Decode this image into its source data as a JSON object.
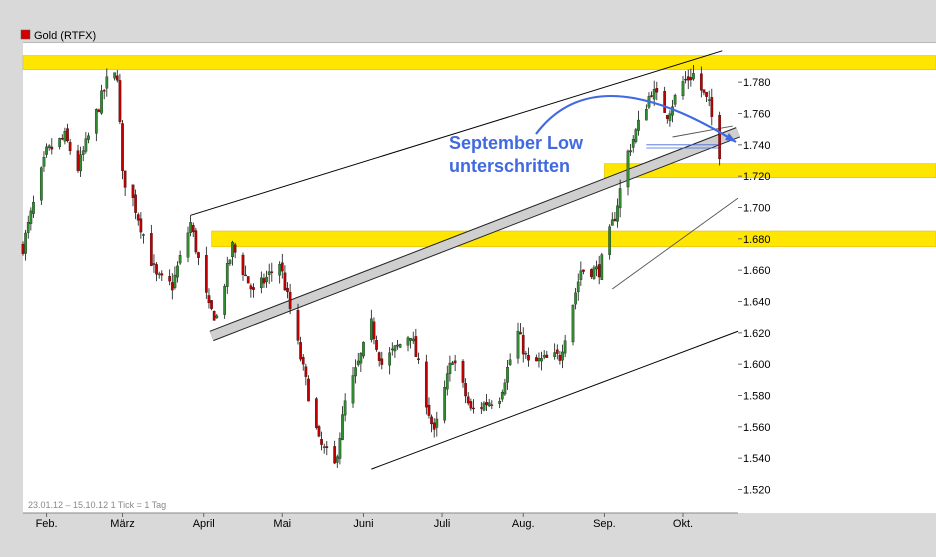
{
  "header": {
    "instrument": "Gold (RTFX)"
  },
  "chart_data": {
    "type": "candlestick",
    "title": "Gold (RTFX)",
    "footer_note": "23.01.12 – 15.10.12   1 Tick = 1 Tag",
    "annotation": [
      "September Low",
      "unterschritten"
    ],
    "y_ticks": [
      "1.520",
      "1.540",
      "1.560",
      "1.580",
      "1.600",
      "1.620",
      "1.640",
      "1.660",
      "1.680",
      "1.700",
      "1.720",
      "1.740",
      "1.760",
      "1.780"
    ],
    "y_tick_values": [
      1520,
      1540,
      1560,
      1580,
      1600,
      1620,
      1640,
      1660,
      1680,
      1700,
      1720,
      1740,
      1760,
      1780
    ],
    "ylim": [
      1505,
      1805
    ],
    "x_months": [
      {
        "label": "Feb.",
        "date": "2012-02-01"
      },
      {
        "label": "März",
        "date": "2012-03-01"
      },
      {
        "label": "April",
        "date": "2012-04-01"
      },
      {
        "label": "Mai",
        "date": "2012-05-01"
      },
      {
        "label": "Juni",
        "date": "2012-06-01"
      },
      {
        "label": "Juli",
        "date": "2012-07-01"
      },
      {
        "label": "Aug.",
        "date": "2012-08-01"
      },
      {
        "label": "Sep.",
        "date": "2012-09-01"
      },
      {
        "label": "Okt.",
        "date": "2012-10-01"
      }
    ],
    "xlim": [
      "2012-01-23",
      "2012-10-22"
    ],
    "price_path": [
      [
        "2012-01-23",
        1675
      ],
      [
        "2012-02-01",
        1735
      ],
      [
        "2012-02-08",
        1745
      ],
      [
        "2012-02-13",
        1725
      ],
      [
        "2012-02-24",
        1780
      ],
      [
        "2012-02-28",
        1785
      ],
      [
        "2012-03-01",
        1720
      ],
      [
        "2012-03-05",
        1705
      ],
      [
        "2012-03-14",
        1655
      ],
      [
        "2012-03-20",
        1650
      ],
      [
        "2012-03-27",
        1690
      ],
      [
        "2012-04-03",
        1635
      ],
      [
        "2012-04-06",
        1630
      ],
      [
        "2012-04-12",
        1675
      ],
      [
        "2012-04-20",
        1645
      ],
      [
        "2012-04-30",
        1665
      ],
      [
        "2012-05-04",
        1635
      ],
      [
        "2012-05-15",
        1550
      ],
      [
        "2012-05-21",
        1535
      ],
      [
        "2012-05-25",
        1575
      ],
      [
        "2012-06-04",
        1625
      ],
      [
        "2012-06-08",
        1600
      ],
      [
        "2012-06-19",
        1620
      ],
      [
        "2012-06-28",
        1555
      ],
      [
        "2012-07-05",
        1605
      ],
      [
        "2012-07-12",
        1570
      ],
      [
        "2012-07-23",
        1580
      ],
      [
        "2012-07-30",
        1620
      ],
      [
        "2012-08-03",
        1600
      ],
      [
        "2012-08-15",
        1605
      ],
      [
        "2012-08-23",
        1660
      ],
      [
        "2012-08-30",
        1660
      ],
      [
        "2012-09-05",
        1695
      ],
      [
        "2012-09-10",
        1735
      ],
      [
        "2012-09-19",
        1775
      ],
      [
        "2012-09-25",
        1760
      ],
      [
        "2012-10-01",
        1780
      ],
      [
        "2012-10-05",
        1785
      ],
      [
        "2012-10-11",
        1765
      ],
      [
        "2012-10-15",
        1735
      ]
    ],
    "horizontal_zones": [
      {
        "y": [
          1788,
          1797
        ],
        "from": "2012-01-23",
        "color": "#ffe600"
      },
      {
        "y": [
          1719,
          1728
        ],
        "from": "2012-09-01",
        "color": "#ffe600"
      },
      {
        "y": [
          1675,
          1685
        ],
        "from": "2012-04-04",
        "color": "#ffe600"
      }
    ],
    "trend_lines": [
      {
        "style": "thin",
        "p1": [
          "2012-03-27",
          1695
        ],
        "p2": [
          "2012-10-16",
          1800
        ]
      },
      {
        "style": "thin",
        "p1": [
          "2012-09-27",
          1745
        ],
        "p2": [
          "2012-10-20",
          1752
        ]
      },
      {
        "style": "band",
        "p1": [
          "2012-04-04",
          1618
        ],
        "p2": [
          "2012-10-22",
          1748
        ]
      },
      {
        "style": "thin",
        "p1": [
          "2012-09-04",
          1648
        ],
        "p2": [
          "2012-10-22",
          1706
        ]
      },
      {
        "style": "thin",
        "p1": [
          "2012-06-04",
          1533
        ],
        "p2": [
          "2012-10-22",
          1621
        ]
      },
      {
        "style": "thin",
        "p1": [
          "2012-09-17",
          1738
        ],
        "p2": [
          "2012-10-15",
          1738
        ]
      },
      {
        "style": "thin",
        "p1": [
          "2012-09-17",
          1740
        ],
        "p2": [
          "2012-10-15",
          1740
        ]
      }
    ],
    "grid": false,
    "up_color": "#2e8b2e",
    "down_color": "#c00000",
    "annotation_color": "#4169e1",
    "zone_color": "#ffe600"
  }
}
